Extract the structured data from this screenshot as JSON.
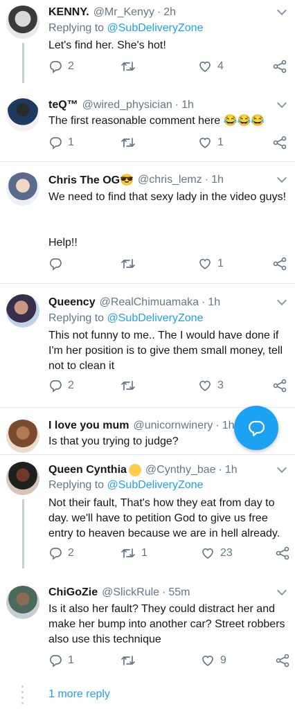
{
  "tweets": [
    {
      "name": "KENNY.",
      "handle": "@Mr_Kenyy",
      "time": "2h",
      "replying_label": "Replying to",
      "replying_to": "@SubDeliveryZone",
      "text": "Let's find her. She's hot!",
      "replies": "2",
      "retweets": "",
      "likes": "4"
    },
    {
      "name": "teQ™",
      "handle": "@wired_physician",
      "time": "1h",
      "text": "The first reasonable comment here 😂😂😂",
      "replies": "1",
      "retweets": "",
      "likes": "1"
    },
    {
      "name": "Chris The OG😎",
      "handle": "@chris_lemz",
      "time": "1h",
      "text": "We need to find that sexy lady in the video guys!",
      "text2": "Help!!",
      "replies": "",
      "retweets": "",
      "likes": "1"
    },
    {
      "name": "Queency",
      "handle": "@RealChimuamaka",
      "time": "1h",
      "replying_label": "Replying to",
      "replying_to": "@SubDeliveryZone",
      "text": "This not funny to me.. The I would have done if I'm her position is to give them small money, tell not to clean it",
      "replies": "2",
      "retweets": "",
      "likes": "3"
    },
    {
      "name": "I love you mum",
      "handle": "@unicornwinery",
      "time": "1h",
      "text": "Is that you trying to judge?"
    },
    {
      "name": "Queen Cynthia",
      "handle": "@Cynthy_bae",
      "time": "1h",
      "replying_label": "Replying to",
      "replying_to": "@SubDeliveryZone",
      "text": "Not their fault, That's how they eat from day to day. we'll have to petition God to give us free entry to heaven because we are in hell already.",
      "replies": "2",
      "retweets": "1",
      "likes": "23"
    },
    {
      "name": "ChiGoZie",
      "handle": "@SlickRule",
      "time": "55m",
      "text": "Is it also her fault? They could distract her and make her bump into another car? Street robbers also use this technique",
      "replies": "1",
      "retweets": "",
      "likes": "9"
    }
  ],
  "more_replies": "1 more reply",
  "colors": {
    "accent": "#1da1f2",
    "muted": "#657786",
    "text": "#14171a",
    "divider": "#e1e8ed"
  },
  "icons": [
    "reply-icon",
    "retweet-icon",
    "like-icon",
    "share-icon",
    "chevron-down-icon",
    "compose-reply-icon"
  ]
}
